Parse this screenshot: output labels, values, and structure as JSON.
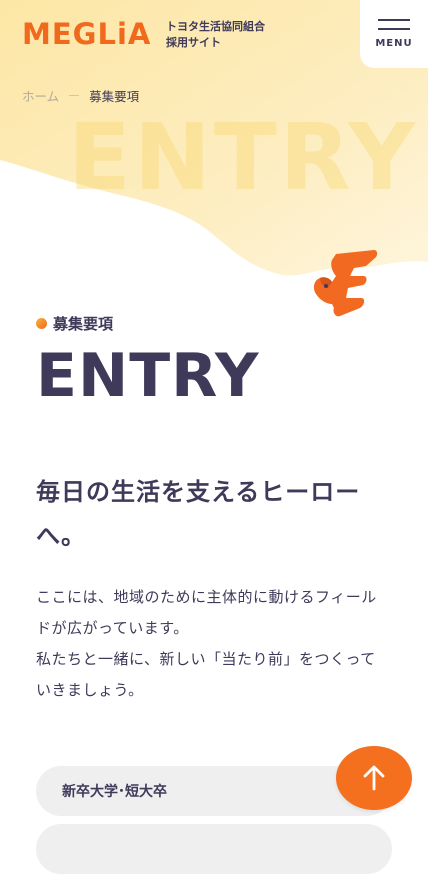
{
  "header": {
    "logo_text": "MEGLiA",
    "tagline_line1": "トヨタ生活協同組合",
    "tagline_line2": "採用サイト",
    "menu_label": "MENU"
  },
  "breadcrumb": {
    "home": "ホーム",
    "current": "募集要項"
  },
  "hero": {
    "watermark": "ENTRY",
    "section_label": "募集要項",
    "title": "ENTRY"
  },
  "content": {
    "headline": "毎日の生活を支えるヒーローへ。",
    "body_lines": [
      "ここには、地域のために主体的に動けるフィール",
      "ドが広がっています。",
      "私たちと一緒に、新しい「当たり前」をつくって",
      "いきましょう。"
    ],
    "category_label": "新卒大学･短大卒"
  },
  "colors": {
    "brand_orange": "#f1691c",
    "text_navy": "#3f3a5a",
    "hero_yellow": "#fde7a6"
  },
  "icons": {
    "menu": "hamburger-icon",
    "scroll_top": "arrow-up-icon",
    "mascot": "mascot-e-character"
  }
}
